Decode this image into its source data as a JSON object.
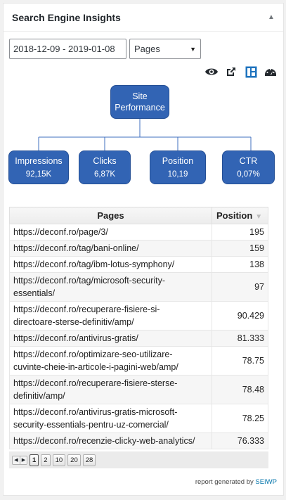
{
  "widget": {
    "title": "Search Engine Insights",
    "collapse_icon": "triangle-up-icon"
  },
  "controls": {
    "date_range": "2018-12-09 - 2019-01-08",
    "report_type": "Pages"
  },
  "toolbar_icons": [
    "eye-icon",
    "external-link-icon",
    "layout-icon",
    "dashboard-gauge-icon"
  ],
  "tree": {
    "root": {
      "line1": "Site",
      "line2": "Performance"
    },
    "metrics": [
      {
        "label": "Impressions",
        "value": "92,15K"
      },
      {
        "label": "Clicks",
        "value": "6,87K"
      },
      {
        "label": "Position",
        "value": "10,19"
      },
      {
        "label": "CTR",
        "value": "0,07%"
      }
    ],
    "node_color": "#3264b4",
    "line_color": "#3f6fbf"
  },
  "table": {
    "headers": {
      "page": "Pages",
      "position": "Position"
    },
    "rows": [
      {
        "line1": "https://deconf.ro/page/3/",
        "line2": "",
        "position": "195"
      },
      {
        "line1": "https://deconf.ro/tag/bani-online/",
        "line2": "",
        "position": "159"
      },
      {
        "line1": "https://deconf.ro/tag/ibm-lotus-symphony/",
        "line2": "",
        "position": "138"
      },
      {
        "line1": "https://deconf.ro/tag/microsoft-security-",
        "line2": "essentials/",
        "position": "97"
      },
      {
        "line1": "https://deconf.ro/recuperare-fisiere-si-",
        "line2": "directoare-sterse-definitiv/amp/",
        "position": "90.429"
      },
      {
        "line1": "https://deconf.ro/antivirus-gratis/",
        "line2": "",
        "position": "81.333"
      },
      {
        "line1": "https://deconf.ro/optimizare-seo-utilizare-",
        "line2": "cuvinte-cheie-in-articole-i-pagini-web/amp/",
        "position": "78.75"
      },
      {
        "line1": "https://deconf.ro/recuperare-fisiere-sterse-",
        "line2": "definitiv/amp/",
        "position": "78.48"
      },
      {
        "line1": "https://deconf.ro/antivirus-gratis-microsoft-",
        "line2": "security-essentials-pentru-uz-comercial/",
        "position": "78.25"
      },
      {
        "line1": "https://deconf.ro/recenzie-clicky-web-analytics/",
        "line2": "",
        "position": "76.333"
      }
    ]
  },
  "pager": {
    "pages": [
      "1",
      "2",
      "10",
      "20",
      "28"
    ],
    "active": "1"
  },
  "footer": {
    "prefix": "report generated by",
    "brand": "SEIWP"
  }
}
